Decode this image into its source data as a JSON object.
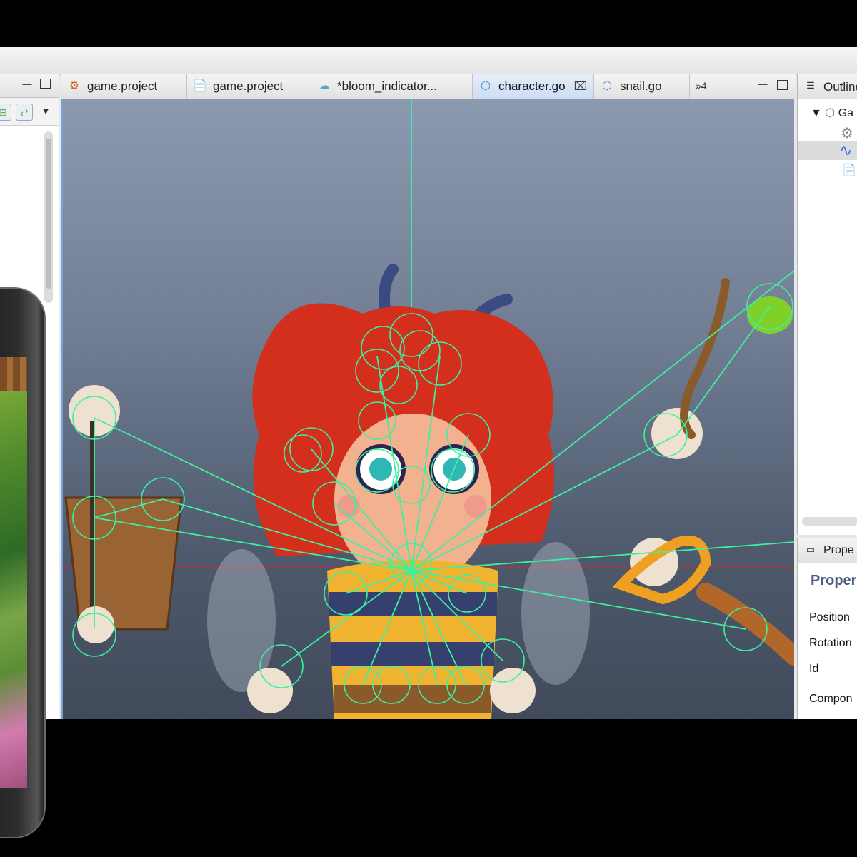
{
  "editor": {
    "tabs": [
      {
        "label": "game.project",
        "icon": "gear-icon",
        "active": false
      },
      {
        "label": "game.project",
        "icon": "document-icon",
        "active": false
      },
      {
        "label": "*bloom_indicator...",
        "icon": "cloud-icon",
        "active": false
      },
      {
        "label": "character.go",
        "icon": "cube-icon",
        "active": true
      },
      {
        "label": "snail.go",
        "icon": "cube-icon",
        "active": false
      }
    ],
    "overflow_label": "»4"
  },
  "outline": {
    "title": "Outline",
    "root_label": "Ga"
  },
  "properties": {
    "tab_label": "Prope",
    "heading": "Proper",
    "labels": [
      "Position",
      "Rotation",
      "Id",
      "Compon"
    ]
  },
  "colors": {
    "viewport_top": "#8c9ab1",
    "viewport_bottom": "#404a5a",
    "bone_green": "#3cf0a0",
    "axis_red": "#e02020",
    "props_heading": "#4c5f80"
  }
}
